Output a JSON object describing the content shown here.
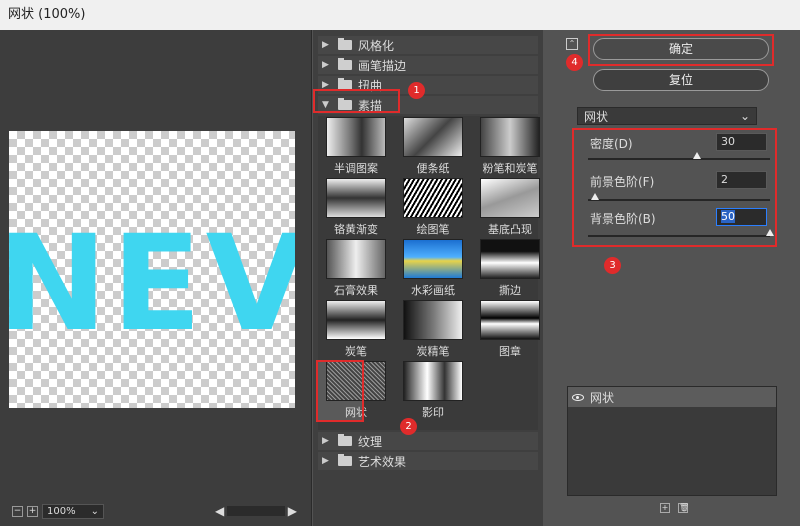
{
  "window": {
    "title": "网状 (100%)"
  },
  "preview": {
    "text": "NEV",
    "text_color": "#3fd6f0",
    "zoom": "100%"
  },
  "categories": {
    "top": [
      {
        "label": "风格化",
        "expanded": false
      },
      {
        "label": "画笔描边",
        "expanded": false
      },
      {
        "label": "扭曲",
        "expanded": false
      },
      {
        "label": "素描",
        "expanded": true
      }
    ],
    "bottom": [
      {
        "label": "纹理",
        "expanded": false
      },
      {
        "label": "艺术效果",
        "expanded": false
      }
    ]
  },
  "filters": [
    {
      "label": "半调图案",
      "icon": "halftone-thumb"
    },
    {
      "label": "便条纸",
      "icon": "notepaper-thumb"
    },
    {
      "label": "粉笔和炭笔",
      "icon": "chalk-charcoal-thumb"
    },
    {
      "label": "铬黄渐变",
      "icon": "chrome-thumb"
    },
    {
      "label": "绘图笔",
      "icon": "graphic-pen-thumb"
    },
    {
      "label": "基底凸现",
      "icon": "bas-relief-thumb"
    },
    {
      "label": "石膏效果",
      "icon": "plaster-thumb"
    },
    {
      "label": "水彩画纸",
      "icon": "water-paper-thumb"
    },
    {
      "label": "撕边",
      "icon": "torn-edges-thumb"
    },
    {
      "label": "炭笔",
      "icon": "charcoal-thumb"
    },
    {
      "label": "炭精笔",
      "icon": "conte-crayon-thumb"
    },
    {
      "label": "图章",
      "icon": "stamp-thumb"
    },
    {
      "label": "网状",
      "icon": "reticulation-thumb",
      "selected": true
    },
    {
      "label": "影印",
      "icon": "photocopy-thumb"
    }
  ],
  "buttons": {
    "ok": "确定",
    "reset": "复位"
  },
  "filter_select": {
    "value": "网状"
  },
  "params": [
    {
      "label": "密度(D)",
      "value": "30",
      "level": 0.6
    },
    {
      "label": "前景色阶(F)",
      "value": "2",
      "level": 0.04
    },
    {
      "label": "背景色阶(B)",
      "value": "50",
      "level": 1.0,
      "focused": true
    }
  ],
  "layer": {
    "name": "网状"
  },
  "annotations": [
    "1",
    "2",
    "3",
    "4"
  ],
  "colors": {
    "highlight": "#e02b2b",
    "accent": "#2b7fff",
    "text_fill": "#3fd6f0"
  }
}
